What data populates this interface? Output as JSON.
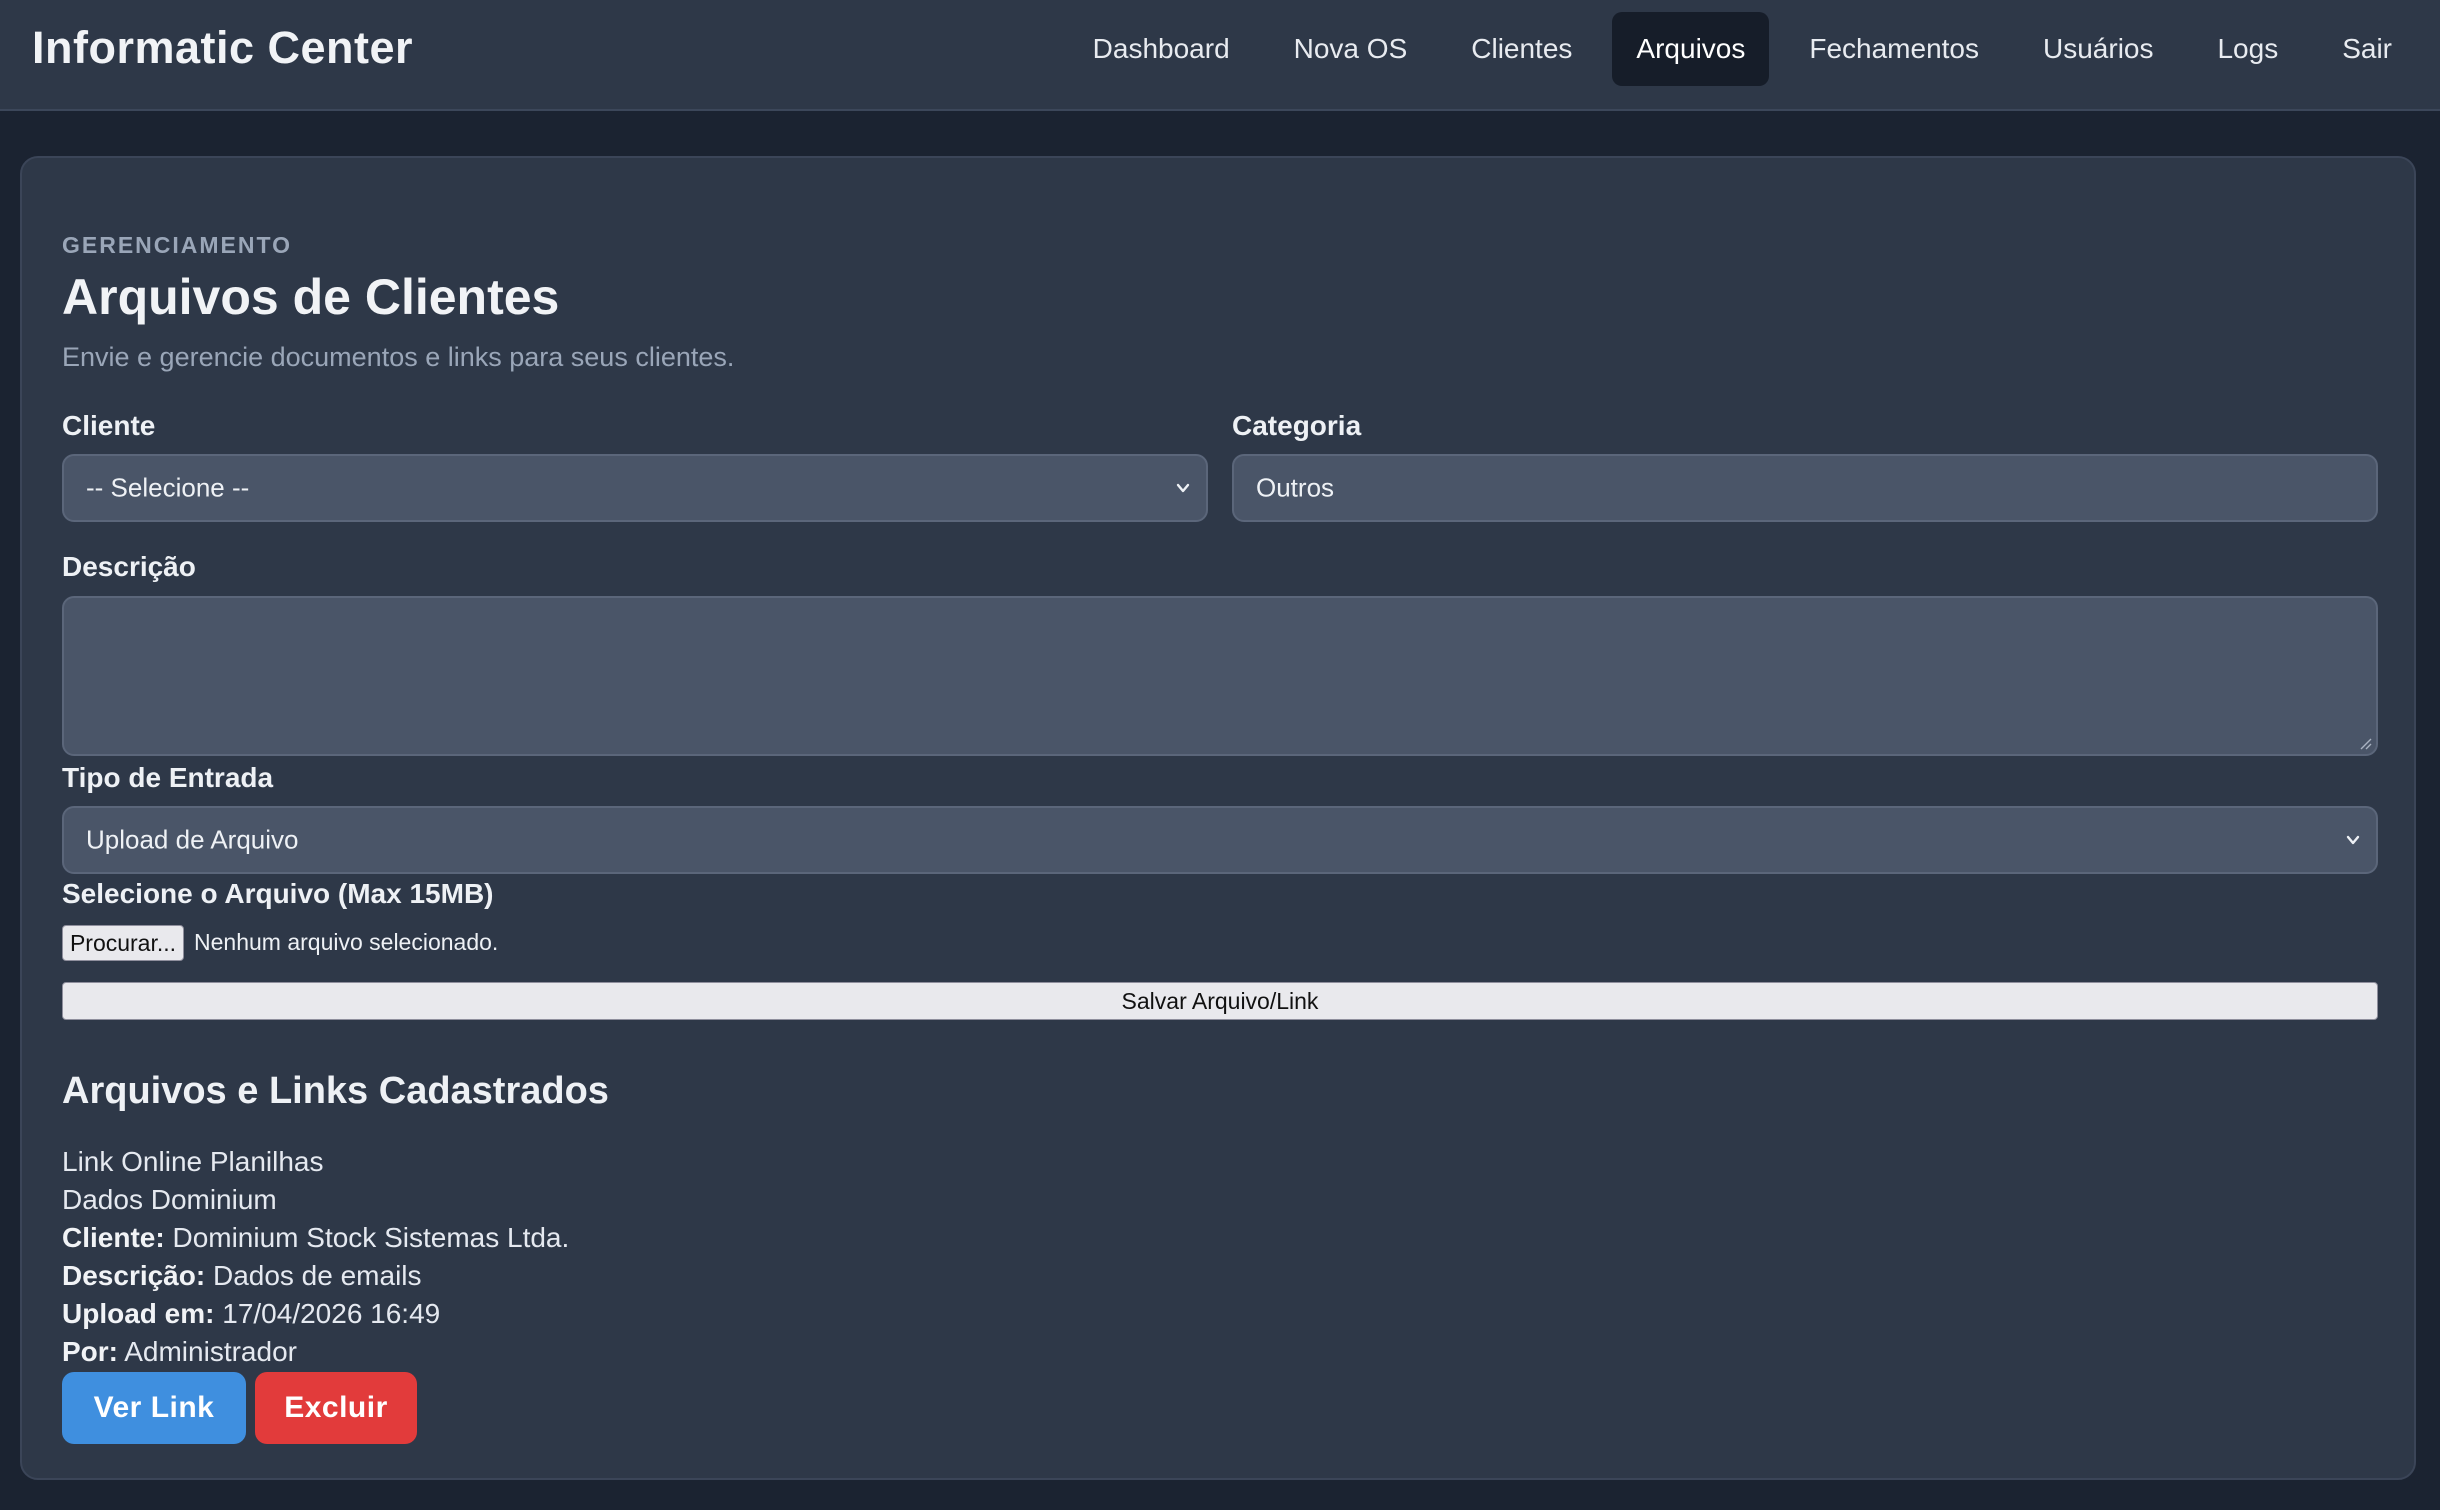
{
  "app": {
    "brand": "Informatic Center"
  },
  "nav": {
    "items": [
      {
        "label": "Dashboard",
        "active": false
      },
      {
        "label": "Nova OS",
        "active": false
      },
      {
        "label": "Clientes",
        "active": false
      },
      {
        "label": "Arquivos",
        "active": true
      },
      {
        "label": "Fechamentos",
        "active": false
      },
      {
        "label": "Usuários",
        "active": false
      },
      {
        "label": "Logs",
        "active": false
      },
      {
        "label": "Sair",
        "active": false
      }
    ]
  },
  "page": {
    "eyebrow": "GERENCIAMENTO",
    "title": "Arquivos de Clientes",
    "subtitle": "Envie e gerencie documentos e links para seus clientes."
  },
  "form": {
    "cliente_label": "Cliente",
    "cliente_value": "-- Selecione --",
    "categoria_label": "Categoria",
    "categoria_value": "Outros",
    "descricao_label": "Descrição",
    "descricao_value": "",
    "tipo_label": "Tipo de Entrada",
    "tipo_value": "Upload de Arquivo",
    "arquivo_label": "Selecione o Arquivo (Max 15MB)",
    "browse_label": "Procurar...",
    "file_status": "Nenhum arquivo selecionado.",
    "save_label": "Salvar Arquivo/Link"
  },
  "list": {
    "title": "Arquivos e Links Cadastrados",
    "entries": [
      {
        "name": "Link Online Planilhas",
        "category": "Dados Dominium",
        "cliente_key": "Cliente:",
        "cliente": "Dominium Stock Sistemas Ltda.",
        "descricao_key": "Descrição:",
        "descricao": "Dados de emails",
        "upload_key": "Upload em:",
        "upload": "17/04/2026 16:49",
        "por_key": "Por:",
        "por": "Administrador",
        "view_label": "Ver Link",
        "delete_label": "Excluir"
      }
    ]
  },
  "colors": {
    "background": "#1b2331",
    "panel": "#2e3848",
    "input": "#4a5568",
    "primary": "#3f8fdf",
    "danger": "#e23b3b"
  }
}
